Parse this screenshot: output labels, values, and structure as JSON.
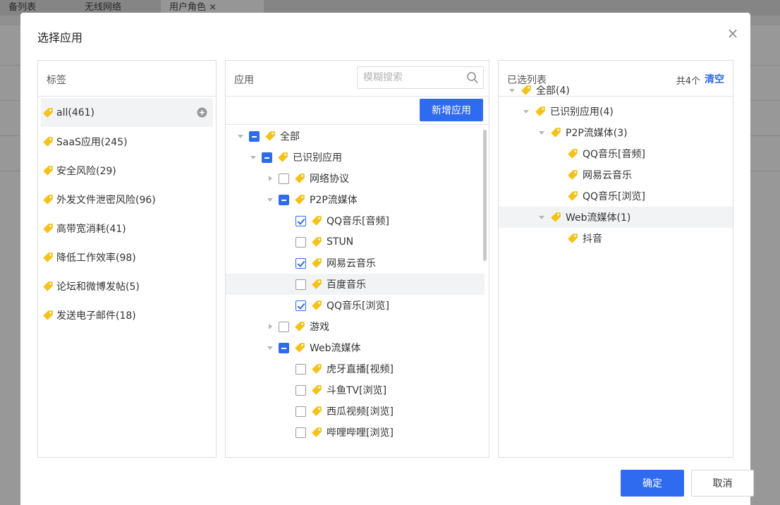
{
  "background": {
    "tabs": [
      {
        "label": "备列表"
      },
      {
        "label": "无线网络"
      },
      {
        "label": "用户角色 ×"
      }
    ]
  },
  "dialog": {
    "title": "选择应用",
    "close_icon": "close-icon"
  },
  "left_panel": {
    "title": "标签",
    "items": [
      {
        "label": "all(461)",
        "selected": true
      },
      {
        "label": "SaaS应用(245)"
      },
      {
        "label": "安全风险(29)"
      },
      {
        "label": "外发文件泄密风险(96)"
      },
      {
        "label": "高带宽消耗(41)"
      },
      {
        "label": "降低工作效率(98)"
      },
      {
        "label": "论坛和微博发帖(5)"
      },
      {
        "label": "发送电子邮件(18)"
      }
    ]
  },
  "middle_panel": {
    "title": "应用",
    "search_placeholder": "模糊搜索",
    "add_button": "新增应用",
    "tree": [
      {
        "label": "全部",
        "level": 0,
        "caret": "down",
        "check": "indeterminate"
      },
      {
        "label": "已识别应用",
        "level": 1,
        "caret": "down",
        "check": "indeterminate"
      },
      {
        "label": "网络协议",
        "level": 2,
        "caret": "right",
        "check": "unchecked"
      },
      {
        "label": "P2P流媒体",
        "level": 2,
        "caret": "down",
        "check": "indeterminate"
      },
      {
        "label": "QQ音乐[音频]",
        "level": 3,
        "caret": "none",
        "check": "checked"
      },
      {
        "label": "STUN",
        "level": 3,
        "caret": "none",
        "check": "unchecked"
      },
      {
        "label": "网易云音乐",
        "level": 3,
        "caret": "none",
        "check": "checked"
      },
      {
        "label": "百度音乐",
        "level": 3,
        "caret": "none",
        "check": "unchecked",
        "hover": true
      },
      {
        "label": "QQ音乐[浏览]",
        "level": 3,
        "caret": "none",
        "check": "checked"
      },
      {
        "label": "游戏",
        "level": 2,
        "caret": "right",
        "check": "unchecked"
      },
      {
        "label": "Web流媒体",
        "level": 2,
        "caret": "down",
        "check": "indeterminate"
      },
      {
        "label": "虎牙直播[视频]",
        "level": 3,
        "caret": "none",
        "check": "unchecked"
      },
      {
        "label": "斗鱼TV[浏览]",
        "level": 3,
        "caret": "none",
        "check": "unchecked"
      },
      {
        "label": "西瓜视频[浏览]",
        "level": 3,
        "caret": "none",
        "check": "unchecked"
      },
      {
        "label": "哔哩哔哩[浏览]",
        "level": 3,
        "caret": "none",
        "check": "unchecked"
      }
    ]
  },
  "right_panel": {
    "title": "已选列表",
    "count": "共4个",
    "clear": "清空",
    "tree": [
      {
        "label": "全部(4)",
        "level": 0,
        "caret": "down"
      },
      {
        "label": "已识别应用(4)",
        "level": 1,
        "caret": "down"
      },
      {
        "label": "P2P流媒体(3)",
        "level": 2,
        "caret": "down"
      },
      {
        "label": "QQ音乐[音频]",
        "level": 3,
        "caret": "none"
      },
      {
        "label": "网易云音乐",
        "level": 3,
        "caret": "none"
      },
      {
        "label": "QQ音乐[浏览]",
        "level": 3,
        "caret": "none"
      },
      {
        "label": "Web流媒体(1)",
        "level": 2,
        "caret": "down",
        "hover": true
      },
      {
        "label": "抖音",
        "level": 3,
        "caret": "none"
      }
    ]
  },
  "footer": {
    "ok": "确定",
    "cancel": "取消"
  },
  "colors": {
    "primary": "#2f6bef",
    "tag": "#f5c21b"
  }
}
